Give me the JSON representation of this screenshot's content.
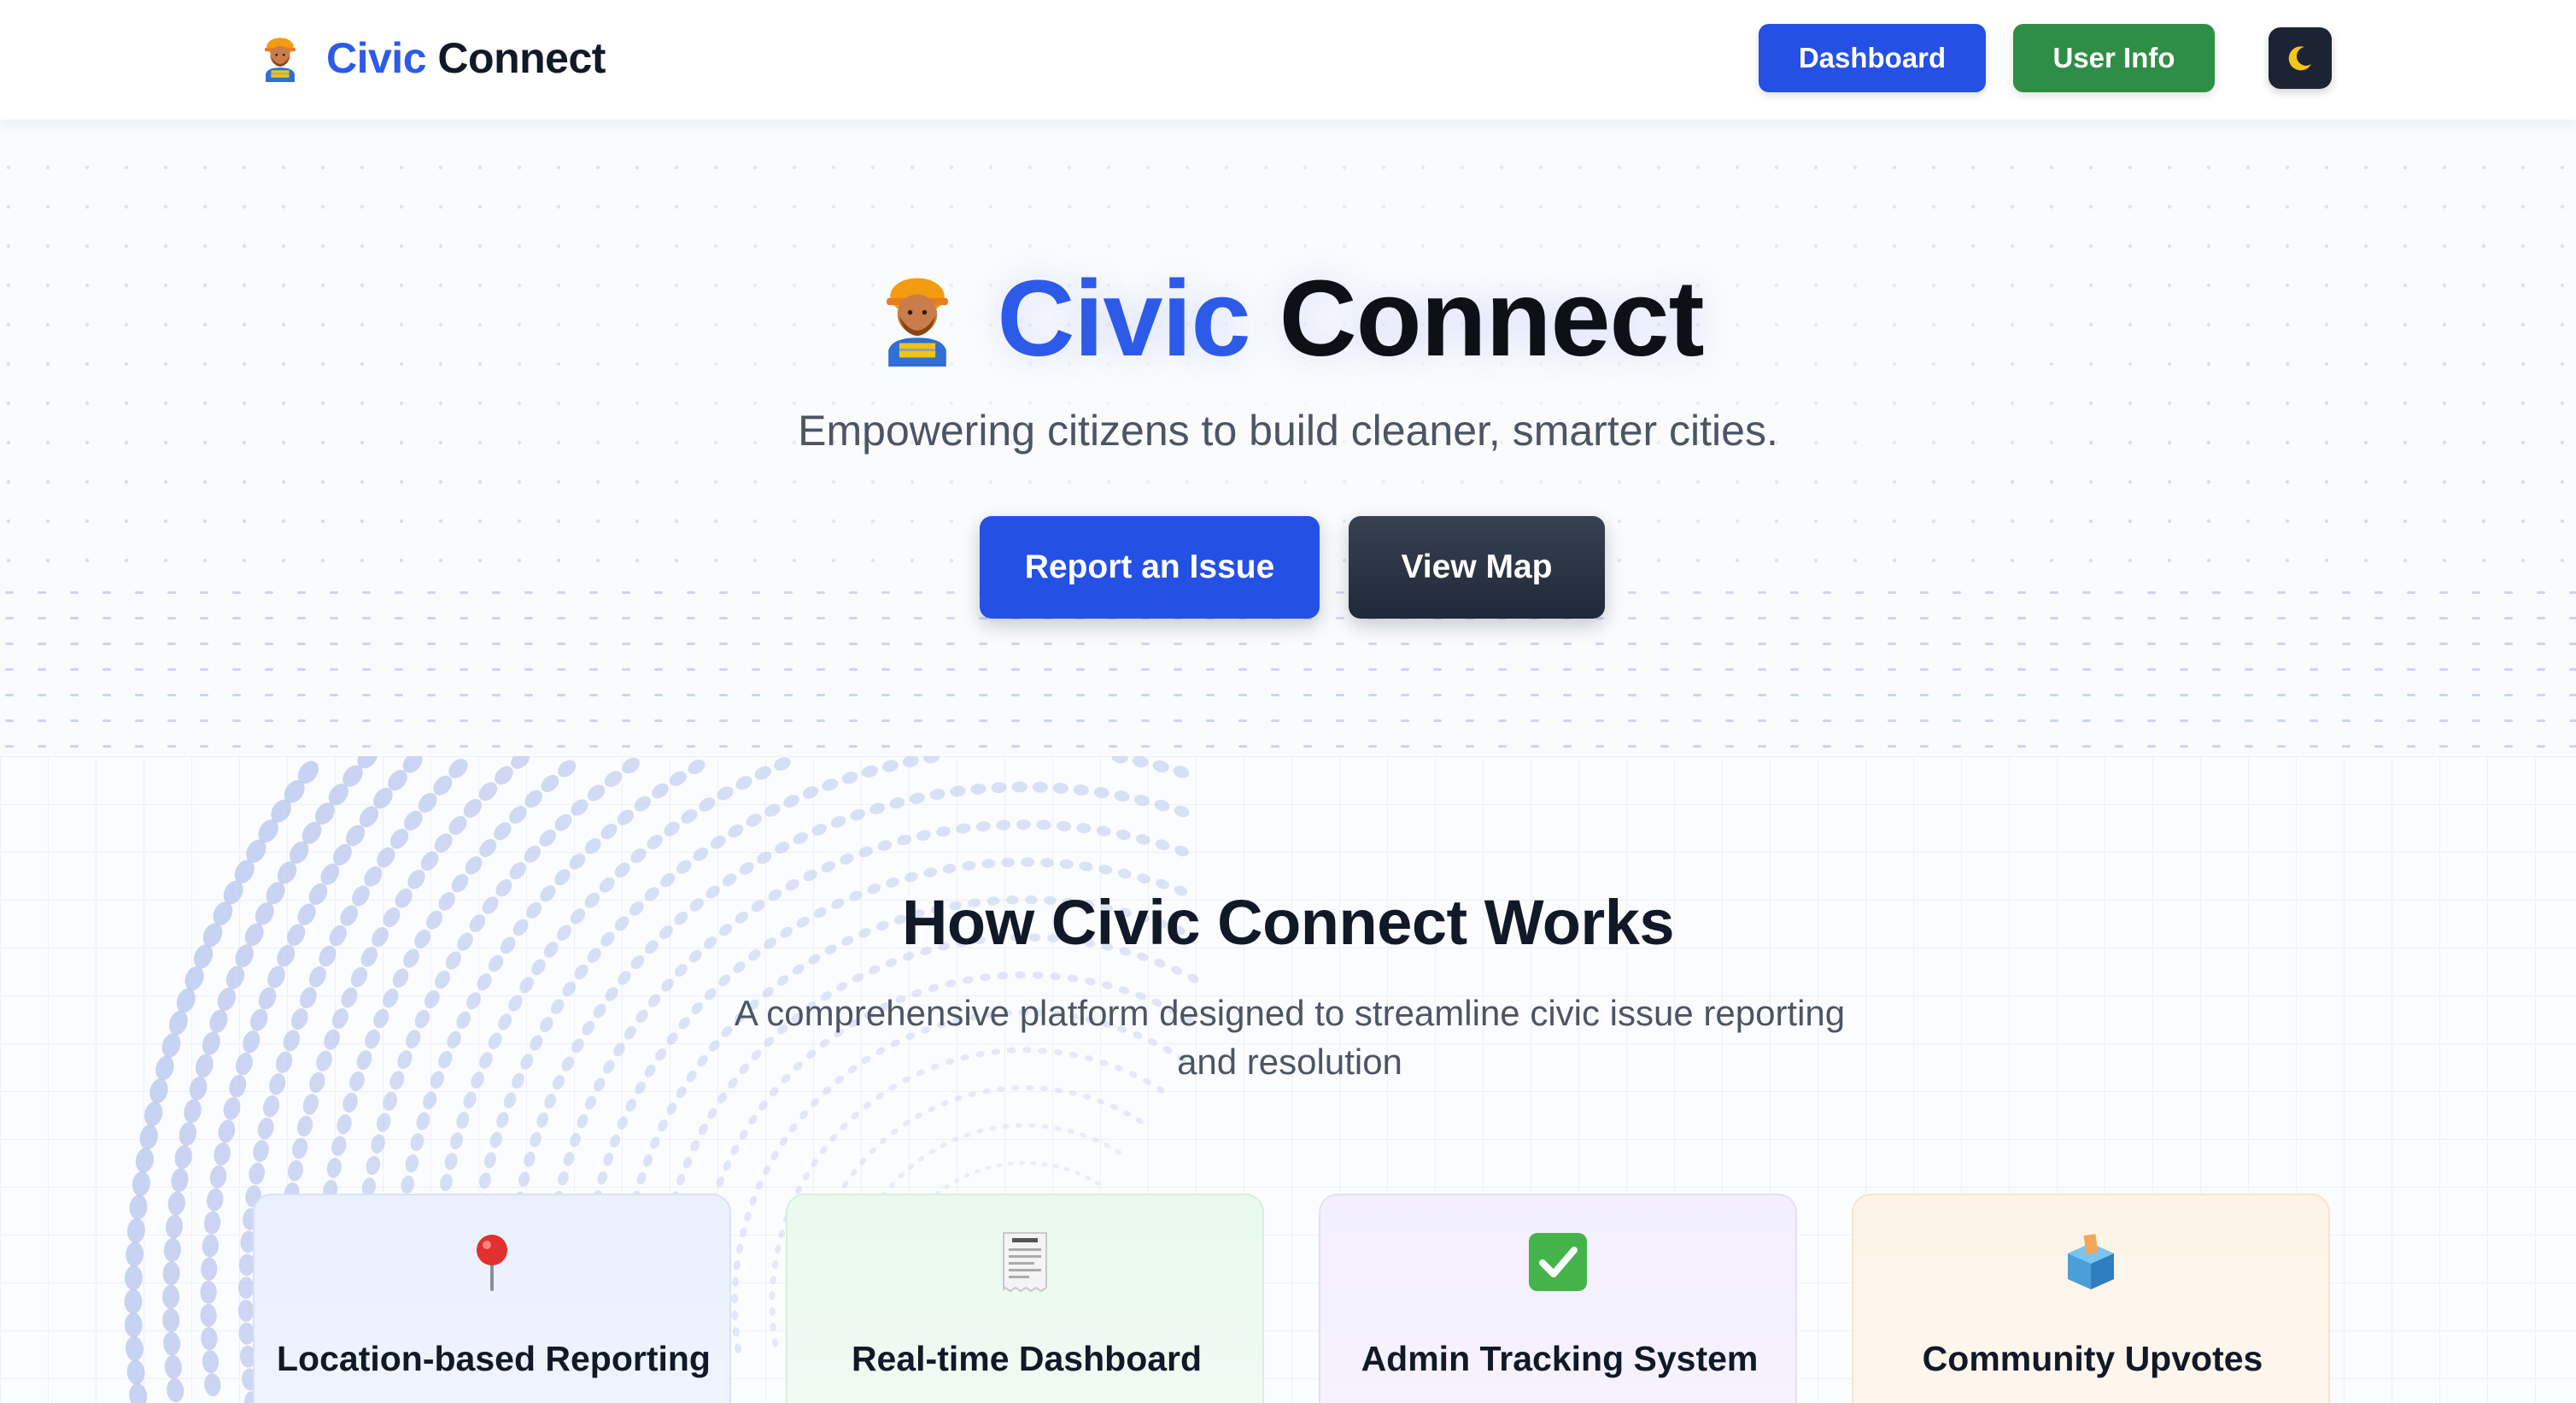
{
  "header": {
    "brand_part1": "Civic",
    "brand_part2": "Connect",
    "dashboard_label": "Dashboard",
    "user_info_label": "User Info",
    "theme_toggle_icon": "moon-icon"
  },
  "hero": {
    "title_part1": "Civic",
    "title_part2": "Connect",
    "subtitle": "Empowering citizens to build cleaner, smarter cities.",
    "report_label": "Report an Issue",
    "map_label": "View Map",
    "mascot_icon": "construction-worker-icon"
  },
  "features": {
    "title": "How Civic Connect Works",
    "subtitle": "A comprehensive platform designed to streamline civic issue reporting and resolution",
    "cards": [
      {
        "title": "Location-based Reporting",
        "icon": "pin-icon"
      },
      {
        "title": "Real-time Dashboard",
        "icon": "receipt-icon"
      },
      {
        "title": "Admin Tracking System",
        "icon": "check-icon"
      },
      {
        "title": "Community Upvotes",
        "icon": "ballot-box-icon"
      }
    ]
  },
  "colors": {
    "primary_blue": "#2450e6",
    "brand_blue": "#2c5ae9",
    "success_green": "#2f8e45",
    "dark": "#1f2937",
    "moon_yellow": "#f5c518"
  }
}
